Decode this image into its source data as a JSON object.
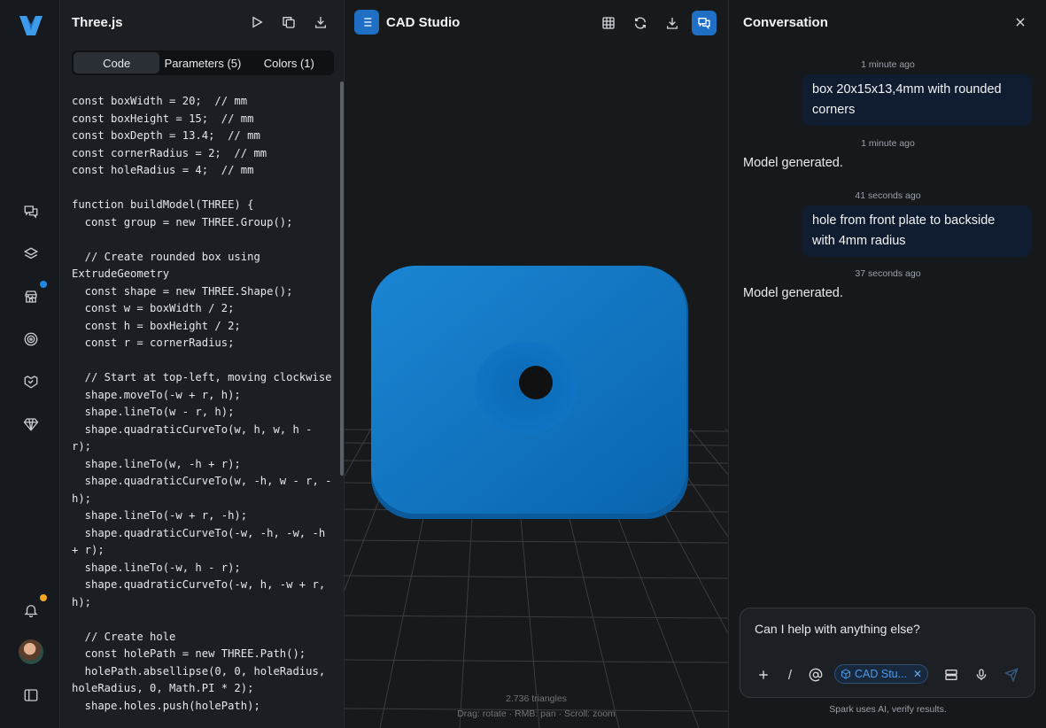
{
  "rail": {
    "icons": [
      "logo-icon",
      "chat-icon",
      "layers-icon",
      "store-icon",
      "target-icon",
      "handshake-icon",
      "diamond-icon",
      "bell-icon",
      "avatar",
      "sidebar-toggle-icon"
    ],
    "badge_colors": {
      "store": "#1e88e5",
      "bell": "#f5a623"
    }
  },
  "code_panel": {
    "title": "Three.js",
    "tabs": [
      {
        "label": "Code",
        "active": true
      },
      {
        "label": "Parameters (5)",
        "active": false
      },
      {
        "label": "Colors (1)",
        "active": false
      }
    ],
    "code_lines": [
      "const boxWidth = 20;  // mm",
      "const boxHeight = 15;  // mm",
      "const boxDepth = 13.4;  // mm",
      "const cornerRadius = 2;  // mm",
      "const holeRadius = 4;  // mm",
      "",
      "function buildModel(THREE) {",
      "  const group = new THREE.Group();",
      "",
      "  // Create rounded box using",
      "ExtrudeGeometry",
      "  const shape = new THREE.Shape();",
      "  const w = boxWidth / 2;",
      "  const h = boxHeight / 2;",
      "  const r = cornerRadius;",
      "",
      "  // Start at top-left, moving clockwise",
      "  shape.moveTo(-w + r, h);",
      "  shape.lineTo(w - r, h);",
      "  shape.quadraticCurveTo(w, h, w, h -",
      "r);",
      "  shape.lineTo(w, -h + r);",
      "  shape.quadraticCurveTo(w, -h, w - r, -",
      "h);",
      "  shape.lineTo(-w + r, -h);",
      "  shape.quadraticCurveTo(-w, -h, -w, -h",
      "+ r);",
      "  shape.lineTo(-w, h - r);",
      "  shape.quadraticCurveTo(-w, h, -w + r,",
      "h);",
      "",
      "  // Create hole",
      "  const holePath = new THREE.Path();",
      "  holePath.absellipse(0, 0, holeRadius,",
      "holeRadius, 0, Math.PI * 2);",
      "  shape.holes.push(holePath);"
    ]
  },
  "viewport": {
    "title": "CAD Studio",
    "triangles": "2.736 triangles",
    "hint": "Drag: rotate · RMB: pan · Scroll: zoom",
    "model_color": "#0e74c4",
    "accent": "#1f6fc5"
  },
  "conversation": {
    "title": "Conversation",
    "messages": [
      {
        "time": "1 minute ago",
        "role": "user",
        "text": "box 20x15x13,4mm with rounded corners"
      },
      {
        "time": "1 minute ago",
        "role": "assistant",
        "text": "Model generated."
      },
      {
        "time": "41 seconds ago",
        "role": "user",
        "text": "hole from front plate to backside with 4mm radius"
      },
      {
        "time": "37 seconds ago",
        "role": "assistant",
        "text": "Model generated."
      }
    ],
    "composer_placeholder": "Can I help with anything else?",
    "chip_label": "CAD Stu...",
    "footer": "Spark uses AI, verify results."
  }
}
